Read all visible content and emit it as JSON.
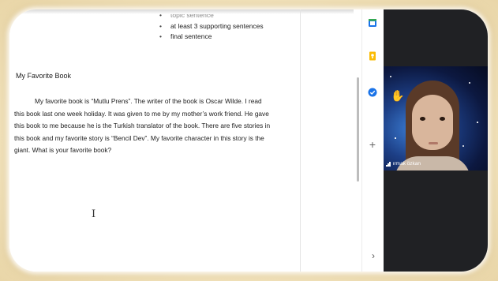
{
  "document": {
    "bullets": [
      "topic sentence",
      "at least 3 supporting sentences",
      "final sentence"
    ],
    "title": "My Favorite Book",
    "paragraph": "My favorite book is “Mutlu Prens”.  The writer of the book is Oscar Wilde. I read this book last one week holiday. It was given to me by my mother’s work friend. He gave this book to me because he is the Turkish translator of the book. There are five stories in this book and my favorite story is “Bencil Dev”. My favorite character in this story is the giant. What is your favorite book?",
    "cursor_glyph": "I"
  },
  "side_panel": {
    "icons": [
      "calendar-icon",
      "keep-icon",
      "tasks-icon",
      "add-icon",
      "expand-icon"
    ],
    "add_glyph": "+",
    "expand_glyph": "›"
  },
  "video": {
    "participant_name": "ırmak özkan",
    "raised_hand_glyph": "✋"
  },
  "colors": {
    "frame": "#f1e2bb",
    "video_bg": "#202124",
    "calendar": "#1a73e8",
    "keep": "#fbbc04",
    "tasks": "#1a73e8"
  }
}
